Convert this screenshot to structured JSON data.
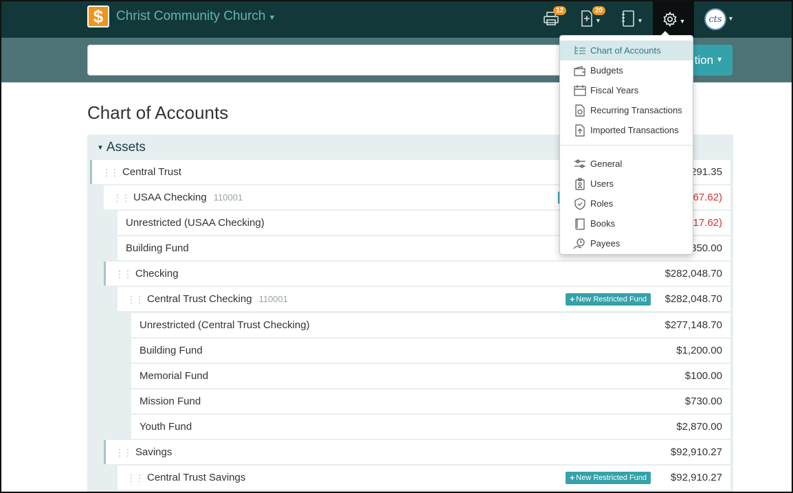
{
  "navbar": {
    "org_name": "Christ Community Church",
    "logo_symbol": "$",
    "print_badge": "12",
    "deposit_badge": "20",
    "avatar_text": "cts"
  },
  "subbar": {
    "action_label": "tion"
  },
  "page": {
    "title": "Chart of Accounts"
  },
  "assets": {
    "heading": "Assets",
    "rows": [
      {
        "name": "Central Trust",
        "amount": "291.35"
      },
      {
        "name": "USAA Checking",
        "number": "110001",
        "amount": "567.62)"
      },
      {
        "name": "Unrestricted (USAA Checking)",
        "amount": "017.62)"
      },
      {
        "name": "Building Fund",
        "amount": "350.00"
      },
      {
        "name": "Checking",
        "amount": "$282,048.70"
      },
      {
        "name": "Central Trust Checking",
        "number": "110001",
        "amount": "$282,048.70"
      },
      {
        "name": "Unrestricted (Central Trust Checking)",
        "amount": "$277,148.70"
      },
      {
        "name": "Building Fund",
        "amount": "$1,200.00"
      },
      {
        "name": "Memorial Fund",
        "amount": "$100.00"
      },
      {
        "name": "Mission Fund",
        "amount": "$730.00"
      },
      {
        "name": "Youth Fund",
        "amount": "$2,870.00"
      },
      {
        "name": "Savings",
        "amount": "$92,910.27"
      },
      {
        "name": "Central Trust Savings",
        "amount": "$92,910.27"
      }
    ],
    "new_restricted_label": "New Restricted Fund"
  },
  "settings_menu": {
    "items": [
      {
        "label": "Chart of Accounts",
        "icon": "chart-of-accounts-icon"
      },
      {
        "label": "Budgets",
        "icon": "wallet-icon"
      },
      {
        "label": "Fiscal Years",
        "icon": "calendar-icon"
      },
      {
        "label": "Recurring Transactions",
        "icon": "recurring-document-icon"
      },
      {
        "label": "Imported Transactions",
        "icon": "import-document-icon"
      },
      {
        "label": "General",
        "icon": "sliders-icon"
      },
      {
        "label": "Users",
        "icon": "id-badge-icon"
      },
      {
        "label": "Roles",
        "icon": "shield-icon"
      },
      {
        "label": "Books",
        "icon": "book-icon"
      },
      {
        "label": "Payees",
        "icon": "payee-icon"
      }
    ]
  },
  "colors": {
    "navbar": "#12383a",
    "accent": "#34a2aa",
    "brand_orange": "#f0941b",
    "negative": "#d6312b"
  }
}
